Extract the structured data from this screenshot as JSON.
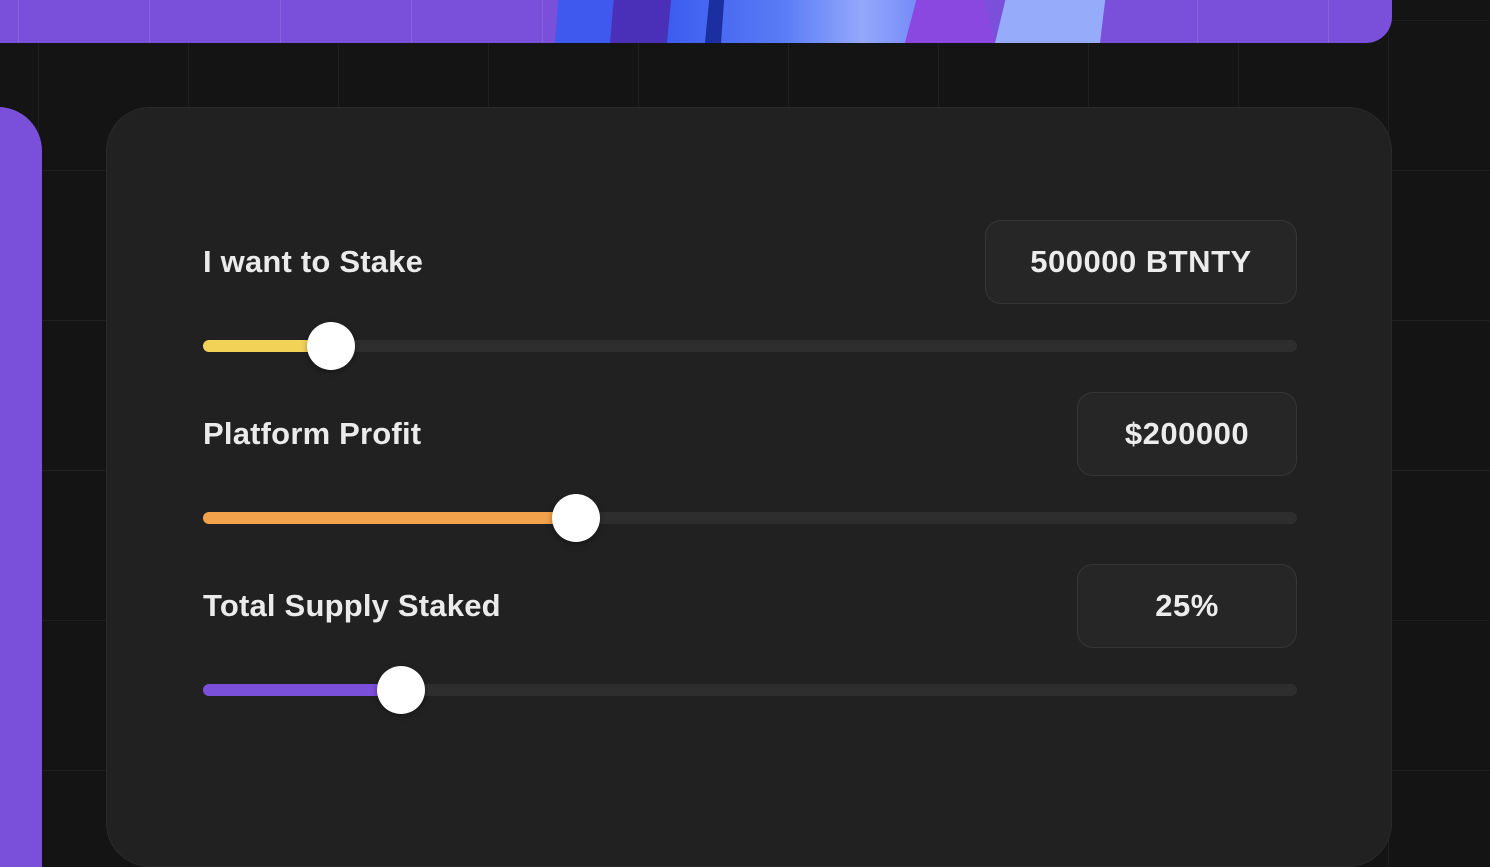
{
  "colors": {
    "background": "#141414",
    "card": "#212121",
    "accent_purple": "#7a4fd9",
    "stake_slider": "#f2d257",
    "profit_slider": "#f2a24a",
    "supply_slider": "#7a4fd9",
    "thumb": "#ffffff"
  },
  "calculator": {
    "rows": [
      {
        "label": "I want to Stake",
        "value": "500000 BTNTY",
        "slider_level_percent": 11.7,
        "color": "#f2d257"
      },
      {
        "label": "Platform Profit",
        "value": "$200000",
        "slider_level_percent": 34.1,
        "color": "#f2a24a"
      },
      {
        "label": "Total Supply Staked",
        "value": "25%",
        "slider_level_percent": 18.1,
        "color": "#7a4fd9"
      }
    ]
  }
}
